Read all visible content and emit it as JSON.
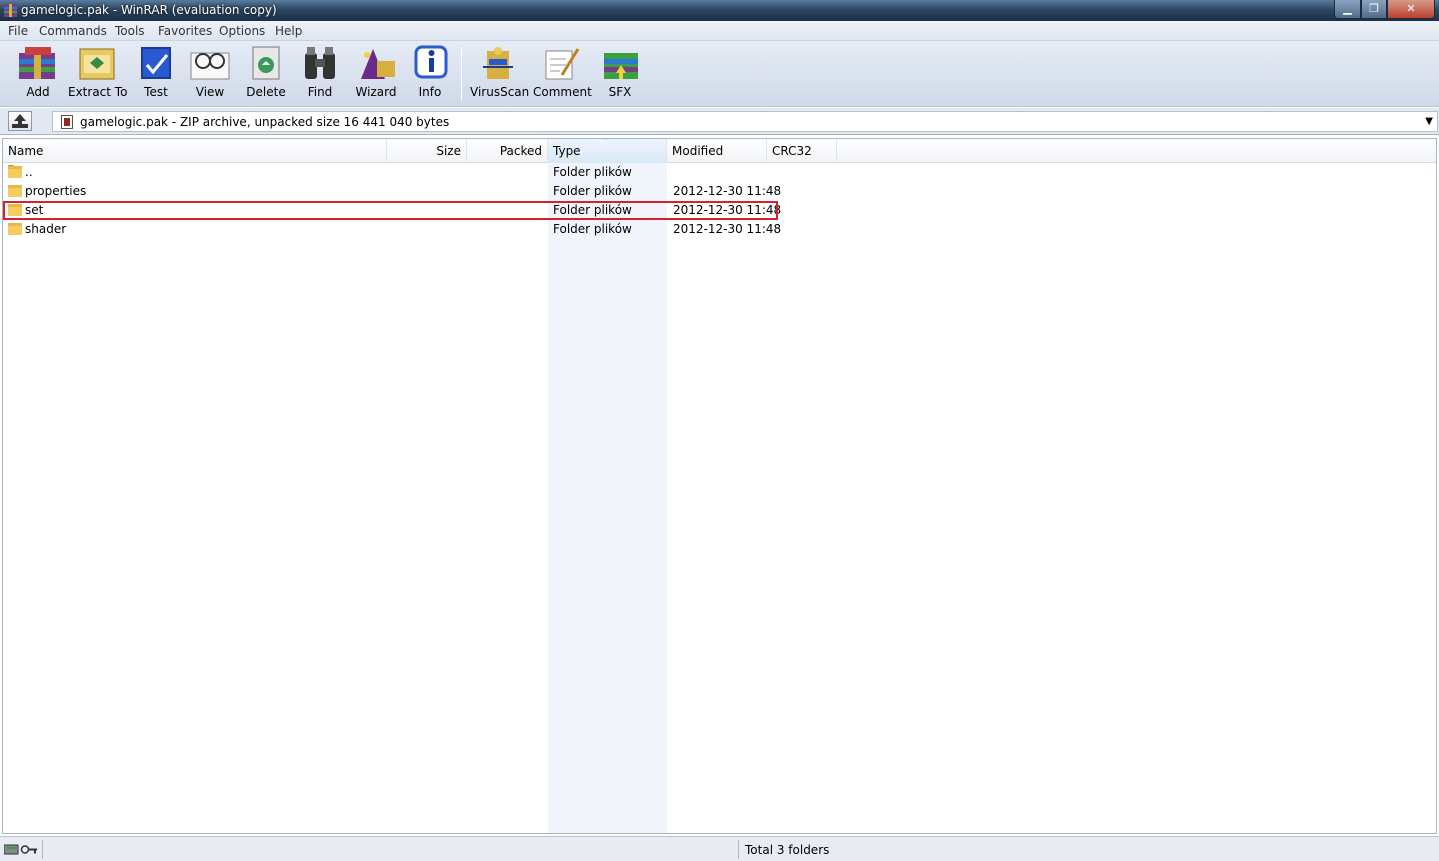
{
  "window": {
    "title": "gamelogic.pak - WinRAR (evaluation copy)",
    "controls": {
      "minimize": "▁",
      "maximize": "❐",
      "close": "✕"
    }
  },
  "menu": [
    "File",
    "Commands",
    "Tools",
    "Favorites",
    "Options",
    "Help"
  ],
  "toolbar": {
    "buttons": [
      {
        "label": "Add",
        "icon": "add-icon"
      },
      {
        "label": "Extract To",
        "icon": "extract-to-icon"
      },
      {
        "label": "Test",
        "icon": "test-icon"
      },
      {
        "label": "View",
        "icon": "view-icon"
      },
      {
        "label": "Delete",
        "icon": "delete-icon"
      },
      {
        "label": "Find",
        "icon": "find-icon"
      },
      {
        "label": "Wizard",
        "icon": "wizard-icon"
      },
      {
        "label": "Info",
        "icon": "info-icon"
      },
      {
        "label": "VirusScan",
        "icon": "virusscan-icon"
      },
      {
        "label": "Comment",
        "icon": "comment-icon"
      },
      {
        "label": "SFX",
        "icon": "sfx-icon"
      }
    ]
  },
  "address": {
    "text": "gamelogic.pak - ZIP archive, unpacked size 16 441 040 bytes",
    "dropdown": "▼"
  },
  "columns": [
    "Name",
    "Size",
    "Packed",
    "Type",
    "Modified",
    "CRC32"
  ],
  "sorted_column": "Type",
  "sort_indicator": "˄",
  "rows": [
    {
      "name": "..",
      "size": "",
      "packed": "",
      "type": "Folder plików",
      "modified": "",
      "crc32": ""
    },
    {
      "name": "properties",
      "size": "",
      "packed": "",
      "type": "Folder plików",
      "modified": "2012-12-30 11:48",
      "crc32": ""
    },
    {
      "name": "set",
      "size": "",
      "packed": "",
      "type": "Folder plików",
      "modified": "2012-12-30 11:48",
      "crc32": ""
    },
    {
      "name": "shader",
      "size": "",
      "packed": "",
      "type": "Folder plików",
      "modified": "2012-12-30 11:48",
      "crc32": ""
    }
  ],
  "highlighted_row": "set",
  "status": {
    "total": "Total 3 folders"
  },
  "colors": {
    "highlight_border": "#d8202e",
    "folder": "#e8b84a",
    "titlebar": "#2d4864"
  }
}
